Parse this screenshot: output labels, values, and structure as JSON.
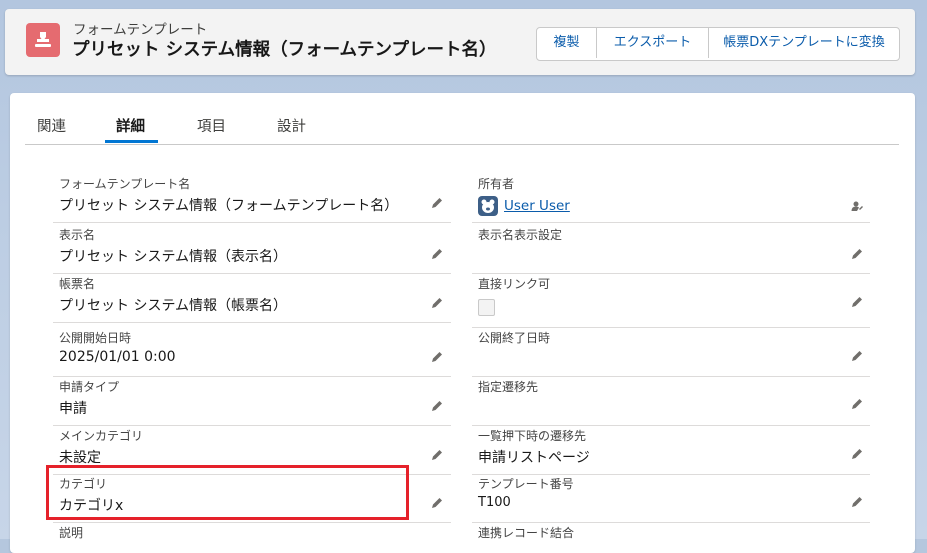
{
  "header": {
    "object_type": "フォームテンプレート",
    "title": "プリセット システム情報（フォームテンプレート名）",
    "buttons": [
      "複製",
      "エクスポート",
      "帳票DXテンプレートに変換"
    ]
  },
  "tabs": [
    "関連",
    "詳細",
    "項目",
    "設計"
  ],
  "active_tab": "詳細",
  "fields_left": [
    {
      "label": "フォームテンプレート名",
      "value": "プリセット システム情報（フォームテンプレート名）"
    },
    {
      "label": "表示名",
      "value": "プリセット システム情報（表示名）"
    },
    {
      "label": "帳票名",
      "value": "プリセット システム情報（帳票名）"
    },
    {
      "label": "公開開始日時",
      "value": "2025/01/01 0:00"
    },
    {
      "label": "申請タイプ",
      "value": "申請"
    },
    {
      "label": "メインカテゴリ",
      "value": "未設定"
    },
    {
      "label": "カテゴリ",
      "value": "カテゴリx"
    },
    {
      "label": "説明",
      "value": ""
    }
  ],
  "fields_right": [
    {
      "label": "所有者",
      "value": "User User"
    },
    {
      "label": "表示名表示設定",
      "value": ""
    },
    {
      "label": "直接リンク可",
      "value": ""
    },
    {
      "label": "公開終了日時",
      "value": ""
    },
    {
      "label": "指定遷移先",
      "value": ""
    },
    {
      "label": "一覧押下時の遷移先",
      "value": "申請リストページ"
    },
    {
      "label": "テンプレート番号",
      "value": "T100"
    },
    {
      "label": "連携レコード結合",
      "value": ""
    }
  ],
  "colors": {
    "accent": "#0176d3",
    "link": "#0b5cab",
    "object_icon": "#e56b70",
    "highlight": "#e5212a"
  },
  "icons": {
    "object": "stamp-icon",
    "edit": "pencil-icon",
    "owner_avatar": "bear-avatar-icon",
    "change_owner": "change-owner-icon"
  }
}
